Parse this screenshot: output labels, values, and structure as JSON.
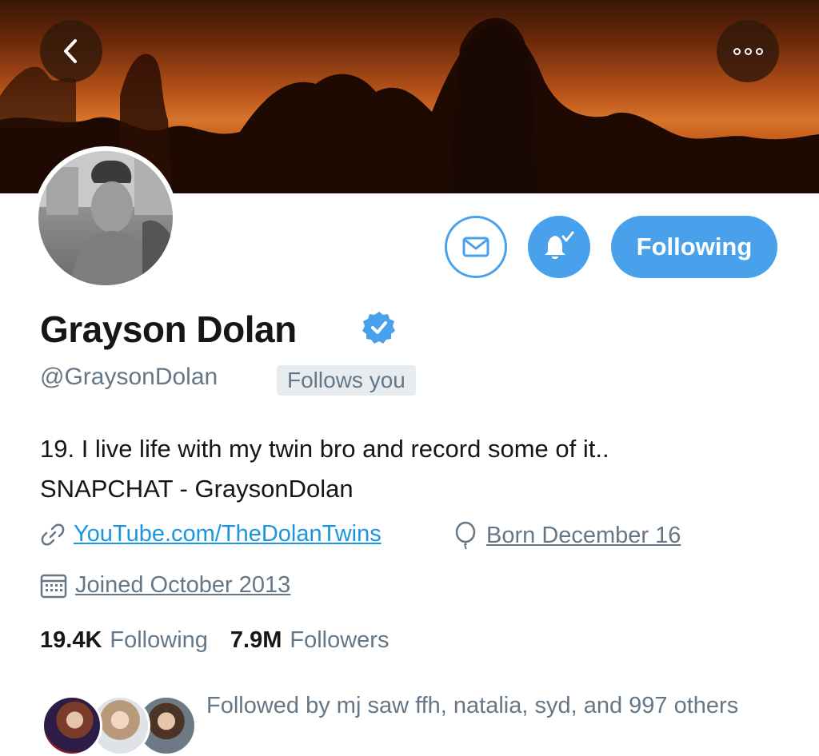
{
  "profile": {
    "name": "Grayson Dolan",
    "handle": "@GraysonDolan",
    "follows_you": "Follows you",
    "bio_lines": [
      "19. I live life with my twin bro and record some of it..",
      "SNAPCHAT - GraysonDolan"
    ],
    "website": "YouTube.com/TheDolanTwins",
    "birthday": "Born December 16",
    "joined": "Joined October 2013"
  },
  "actions": {
    "following_label": "Following"
  },
  "stats": {
    "following_count": "19.4K",
    "following_label": "Following",
    "followers_count": "7.9M",
    "followers_label": "Followers"
  },
  "followed_by": {
    "text": "Followed by mj saw ffh, natalia, syd, and 997 others"
  },
  "icons": [
    "back-arrow-icon",
    "more-options-icon",
    "envelope-icon",
    "bell-check-icon",
    "verified-badge-icon",
    "link-icon",
    "balloon-icon",
    "calendar-icon"
  ],
  "colors": {
    "accent": "#4aa1eb",
    "link": "#1b95e0",
    "secondary_text": "#657786",
    "primary_text": "#14171a",
    "banner": "#c25a18"
  }
}
